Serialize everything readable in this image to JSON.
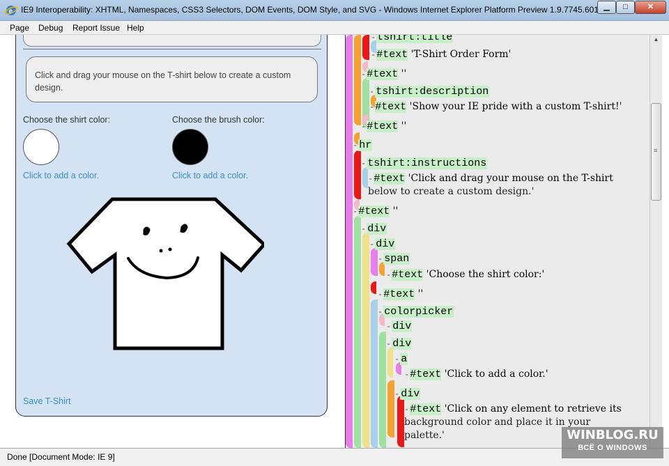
{
  "window": {
    "title": "IE9 Interoperability: XHTML, Namespaces, CSS3 Selectors, DOM Events, DOM Style, and SVG - Windows Internet Explorer Platform Preview 1.9.7745.6019",
    "min_glyph": "▁",
    "max_glyph": "□",
    "close_glyph": "✕"
  },
  "menu": [
    "Page",
    "Debug",
    "Report Issue",
    "Help"
  ],
  "form": {
    "instructions": "Click and drag your mouse on the T-shirt below to create a custom design.",
    "shirt_color_label": "Choose the shirt color:",
    "brush_color_label": "Choose the brush color:",
    "shirt_color": "#ffffff",
    "brush_color": "#000000",
    "add_color_link": "Click to add a color.",
    "save_link": "Save T-Shirt"
  },
  "tree": {
    "nodes": [
      {
        "label": "tshirt:title",
        "kind": "element"
      },
      {
        "label": "#text",
        "str": "'T-Shirt Order Form'",
        "kind": "text"
      },
      {
        "label": "#text",
        "str": "''",
        "kind": "text"
      },
      {
        "label": "tshirt:description",
        "kind": "element"
      },
      {
        "label": "#text",
        "str": "'Show your IE pride with a custom T-shirt!'",
        "kind": "text"
      },
      {
        "label": "#text",
        "str": "''",
        "kind": "text"
      },
      {
        "label": "hr",
        "kind": "element"
      },
      {
        "label": "tshirt:instructions",
        "kind": "element"
      },
      {
        "label": "#text",
        "str": "'Click and drag your mouse on the T-shirt",
        "kind": "text"
      },
      {
        "label": "",
        "str": "below to create a custom design.'",
        "kind": "wrap"
      },
      {
        "label": "#text",
        "str": "''",
        "kind": "text"
      },
      {
        "label": "div",
        "kind": "element"
      },
      {
        "label": "div",
        "kind": "element"
      },
      {
        "label": "span",
        "kind": "element"
      },
      {
        "label": "#text",
        "str": "'Choose the shirt color:'",
        "kind": "text"
      },
      {
        "label": "#text",
        "str": "''",
        "kind": "text"
      },
      {
        "label": "colorpicker",
        "kind": "element"
      },
      {
        "label": "div",
        "kind": "element"
      },
      {
        "label": "div",
        "kind": "element"
      },
      {
        "label": "a",
        "kind": "element"
      },
      {
        "label": "#text",
        "str": "'Click to add a color.'",
        "kind": "text"
      },
      {
        "label": "div",
        "kind": "element"
      },
      {
        "label": "#text",
        "str": "'Click on any element to retrieve its",
        "kind": "text"
      },
      {
        "label": "",
        "str": "background color and place it in your",
        "kind": "wrap"
      },
      {
        "label": "",
        "str": "palette.'",
        "kind": "wrap"
      }
    ]
  },
  "status": "Done [Document Mode: IE 9]",
  "watermark": {
    "line1": "WINBLOG.RU",
    "line2": "ВСЁ О WINDOWS"
  }
}
